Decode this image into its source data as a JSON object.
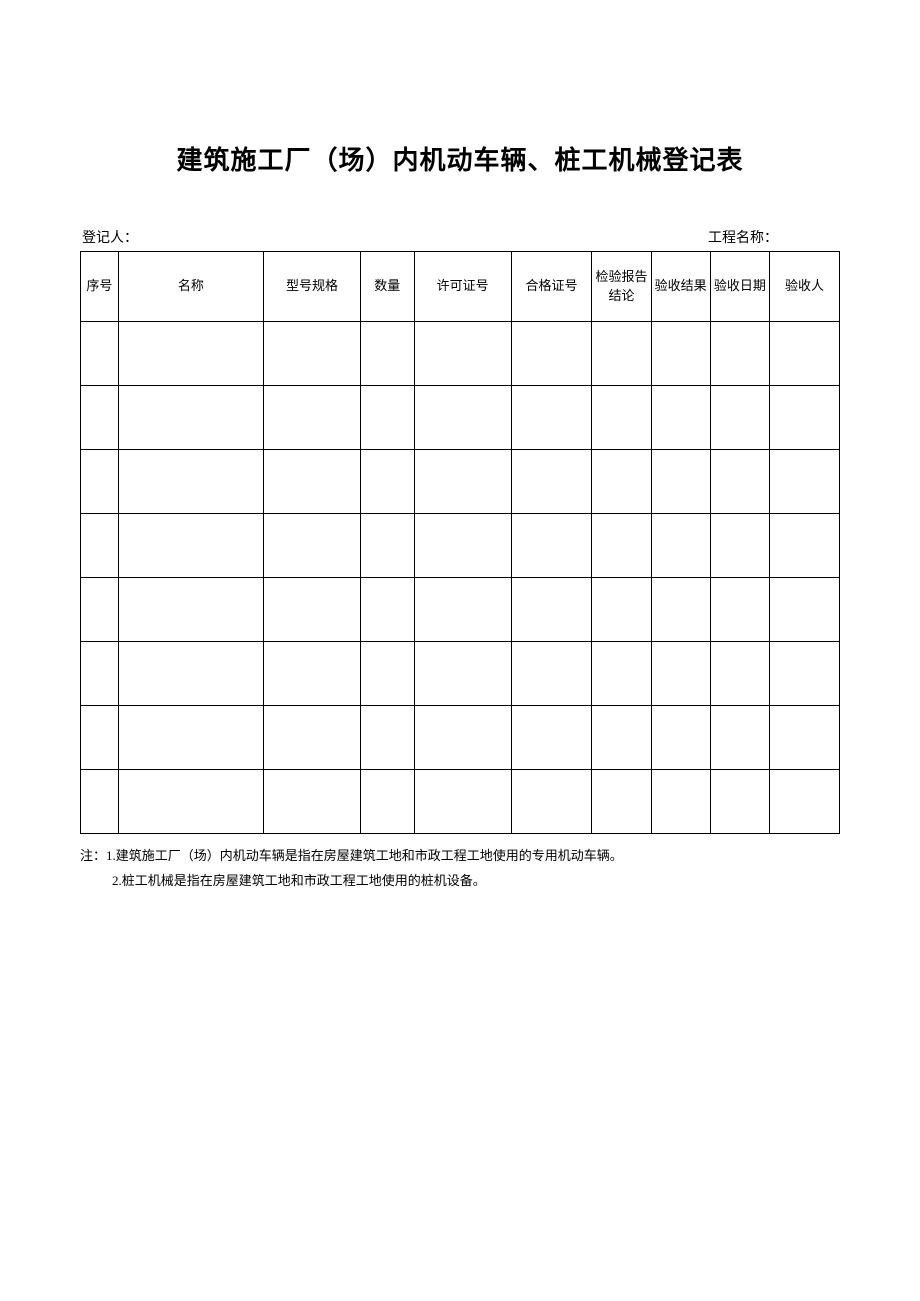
{
  "title": "建筑施工厂（场）内机动车辆、桩工机械登记表",
  "header": {
    "registrant_label": "登记人：",
    "project_label": "工程名称："
  },
  "columns": {
    "seq": "序号",
    "name": "名称",
    "model": "型号规格",
    "qty": "数量",
    "license": "许可证号",
    "cert": "合格证号",
    "report": "检验报告结论",
    "result": "验收结果",
    "date": "验收日期",
    "person": "验收人"
  },
  "rows": [
    {
      "seq": "",
      "name": "",
      "model": "",
      "qty": "",
      "license": "",
      "cert": "",
      "report": "",
      "result": "",
      "date": "",
      "person": ""
    },
    {
      "seq": "",
      "name": "",
      "model": "",
      "qty": "",
      "license": "",
      "cert": "",
      "report": "",
      "result": "",
      "date": "",
      "person": ""
    },
    {
      "seq": "",
      "name": "",
      "model": "",
      "qty": "",
      "license": "",
      "cert": "",
      "report": "",
      "result": "",
      "date": "",
      "person": ""
    },
    {
      "seq": "",
      "name": "",
      "model": "",
      "qty": "",
      "license": "",
      "cert": "",
      "report": "",
      "result": "",
      "date": "",
      "person": ""
    },
    {
      "seq": "",
      "name": "",
      "model": "",
      "qty": "",
      "license": "",
      "cert": "",
      "report": "",
      "result": "",
      "date": "",
      "person": ""
    },
    {
      "seq": "",
      "name": "",
      "model": "",
      "qty": "",
      "license": "",
      "cert": "",
      "report": "",
      "result": "",
      "date": "",
      "person": ""
    },
    {
      "seq": "",
      "name": "",
      "model": "",
      "qty": "",
      "license": "",
      "cert": "",
      "report": "",
      "result": "",
      "date": "",
      "person": ""
    },
    {
      "seq": "",
      "name": "",
      "model": "",
      "qty": "",
      "license": "",
      "cert": "",
      "report": "",
      "result": "",
      "date": "",
      "person": ""
    }
  ],
  "notes": {
    "line1": "注：1.建筑施工厂（场）内机动车辆是指在房屋建筑工地和市政工程工地使用的专用机动车辆。",
    "line2": "2.桩工机械是指在房屋建筑工地和市政工程工地使用的桩机设备。"
  }
}
